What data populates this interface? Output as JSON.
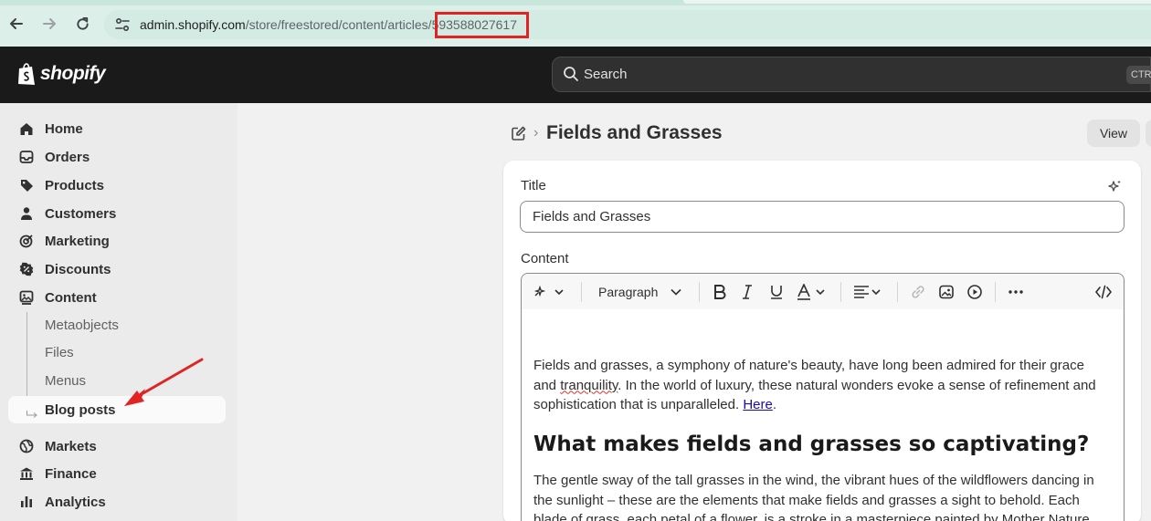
{
  "browser": {
    "url_host": "admin.shopify.com",
    "url_path": "/store/freestored/content/articles/",
    "url_id": "593588027617"
  },
  "topbar": {
    "logo_text": "shopify",
    "search_placeholder": "Search",
    "search_shortcut": "CTR"
  },
  "sidebar": {
    "items": [
      {
        "label": "Home",
        "icon": "home-icon"
      },
      {
        "label": "Orders",
        "icon": "inbox-icon"
      },
      {
        "label": "Products",
        "icon": "tag-icon"
      },
      {
        "label": "Customers",
        "icon": "person-icon"
      },
      {
        "label": "Marketing",
        "icon": "target-icon"
      },
      {
        "label": "Discounts",
        "icon": "discount-icon"
      },
      {
        "label": "Content",
        "icon": "content-icon"
      }
    ],
    "content_subitems": [
      "Metaobjects",
      "Files",
      "Menus"
    ],
    "active_item": "Blog posts",
    "items_bottom": [
      {
        "label": "Markets",
        "icon": "globe-icon"
      },
      {
        "label": "Finance",
        "icon": "bank-icon"
      },
      {
        "label": "Analytics",
        "icon": "bar-chart-icon"
      }
    ]
  },
  "main": {
    "page_title": "Fields and Grasses",
    "view_button": "View",
    "title_label": "Title",
    "title_value": "Fields and Grasses",
    "content_label": "Content",
    "toolbar": {
      "paragraph_select": "Paragraph"
    },
    "body": {
      "p1_a": "Fields and grasses, a symphony of nature's beauty, have long been admired for their grace and ",
      "p1_word": "tranquility",
      "p1_b": ". In the world of luxury, these natural wonders evoke a sense of refinement and sophistication that is unparalleled. ",
      "p1_link": "Here",
      "p1_end": ".",
      "h2": "What makes fields and grasses so captivating?",
      "p2": "The gentle sway of the tall grasses in the wind, the vibrant hues of the wildflowers dancing in the sunlight – these are the elements that make fields and grasses a sight to behold. Each blade of grass, each petal of a flower, is a stroke in a masterpiece painted by Mother Nature."
    }
  },
  "colors": {
    "highlight_box": "#e02424",
    "topbar_bg": "#1a1a1a",
    "sidebar_bg": "#ebebeb",
    "link": "#1a0dab"
  }
}
